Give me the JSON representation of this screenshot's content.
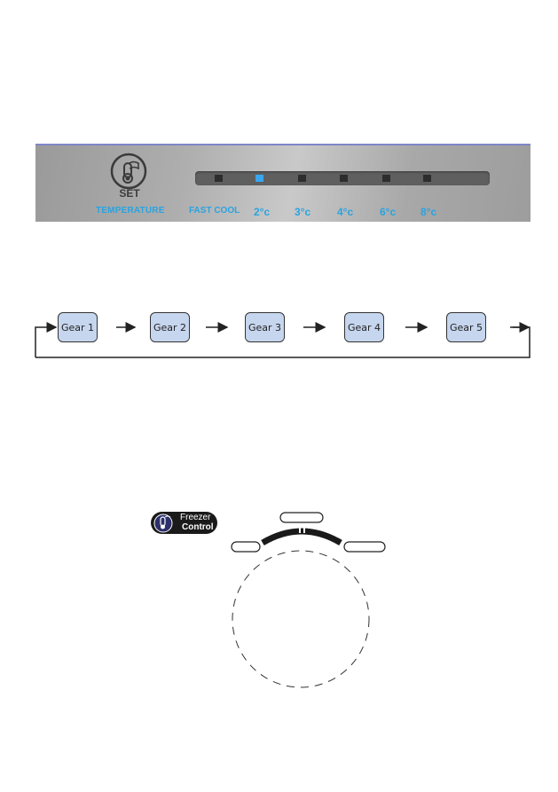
{
  "control_panel": {
    "set_label": "SET",
    "temperature_label": "TEMPERATURE",
    "icon": "thermometer-flag-icon",
    "options": [
      {
        "label": "FAST COOL",
        "active": false
      },
      {
        "label": "2°c",
        "active": true
      },
      {
        "label": "3°c",
        "active": false
      },
      {
        "label": "4°c",
        "active": false
      },
      {
        "label": "6°c",
        "active": false
      },
      {
        "label": "8°c",
        "active": false
      }
    ],
    "colors": {
      "label": "#2aa3e0",
      "led_on": "#3aa6ee",
      "led_off": "#2d2d2d",
      "border": "#7f86c8"
    }
  },
  "gear_cycle": {
    "gears": [
      "Gear 1",
      "Gear 2",
      "Gear 3",
      "Gear 4",
      "Gear 5"
    ],
    "loops_back": true,
    "box_color": "#c6d6ee"
  },
  "freezer_control": {
    "badge_line1": "Freezer",
    "badge_line2": "Control",
    "icon": "thermometer-flag-icon",
    "dial_labels": [
      "",
      "",
      ""
    ]
  }
}
